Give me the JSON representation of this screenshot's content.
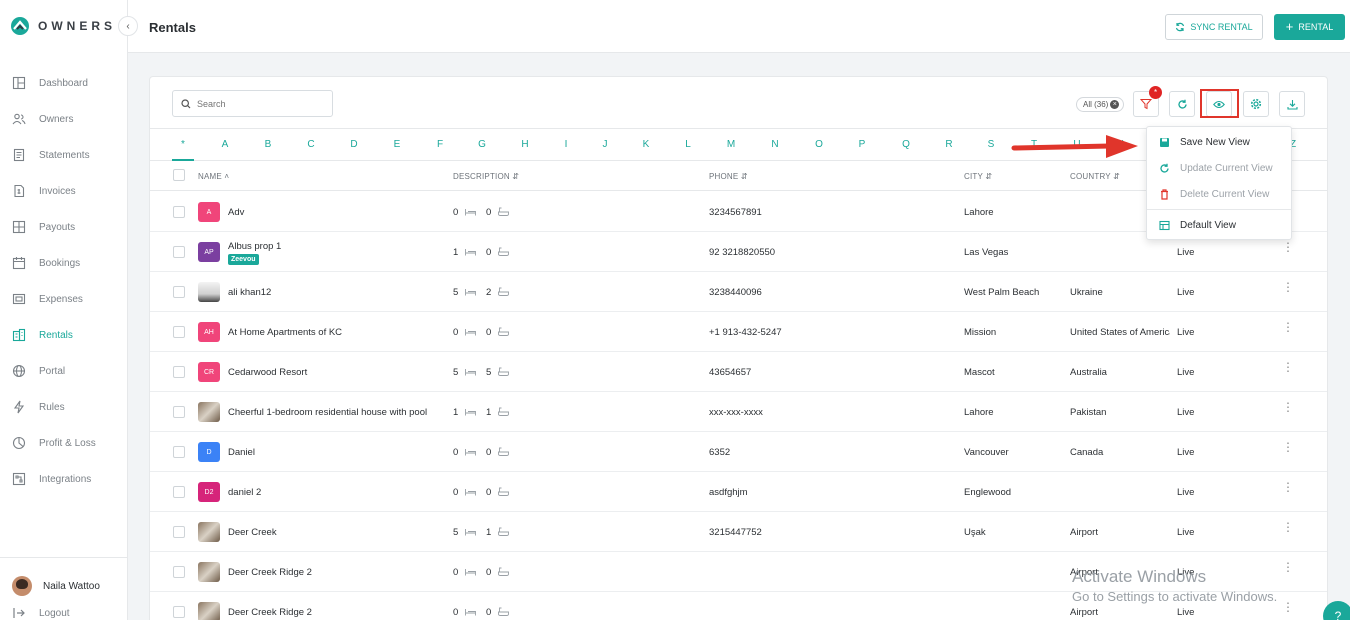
{
  "app": {
    "logo_text": "OWNERS",
    "brand_color": "#1aa89a"
  },
  "sidebar": {
    "items": [
      {
        "label": "Dashboard",
        "icon": "dashboard-icon"
      },
      {
        "label": "Owners",
        "icon": "owners-icon"
      },
      {
        "label": "Statements",
        "icon": "statements-icon"
      },
      {
        "label": "Invoices",
        "icon": "invoices-icon"
      },
      {
        "label": "Payouts",
        "icon": "payouts-icon"
      },
      {
        "label": "Bookings",
        "icon": "bookings-icon"
      },
      {
        "label": "Expenses",
        "icon": "expenses-icon"
      },
      {
        "label": "Rentals",
        "icon": "rentals-icon",
        "active": true
      },
      {
        "label": "Portal",
        "icon": "globe-icon"
      },
      {
        "label": "Rules",
        "icon": "bolt-icon"
      },
      {
        "label": "Profit & Loss",
        "icon": "chart-icon"
      },
      {
        "label": "Integrations",
        "icon": "integrations-icon"
      }
    ],
    "user_name": "Naila Wattoo",
    "logout_label": "Logout"
  },
  "header": {
    "title": "Rentals",
    "sync_label": "SYNC RENTAL",
    "add_label": "RENTAL"
  },
  "toolbar": {
    "search_placeholder": "Search",
    "all_chip": "All (36)",
    "filter_badge": "*"
  },
  "alphabet": [
    "*",
    "A",
    "B",
    "C",
    "D",
    "E",
    "F",
    "G",
    "H",
    "I",
    "J",
    "K",
    "L",
    "M",
    "N",
    "O",
    "P",
    "Q",
    "R",
    "S",
    "T",
    "U",
    "V",
    "W",
    "X",
    "Y",
    "Z"
  ],
  "columns": {
    "name": "NAME",
    "description": "DESCRIPTION",
    "phone": "PHONE",
    "city": "CITY",
    "country": "COUNTRY"
  },
  "rows": [
    {
      "initials": "A",
      "color": "#f0457a",
      "name": "Adv",
      "beds": "0",
      "baths": "0",
      "phone": "3234567891",
      "city": "Lahore",
      "country": "",
      "status": ""
    },
    {
      "initials": "AP",
      "color": "#7b3fa0",
      "name": "Albus prop 1",
      "tag": "Zeevou",
      "beds": "1",
      "baths": "0",
      "phone": "92 3218820550",
      "city": "Las Vegas",
      "country": "",
      "status": "Live"
    },
    {
      "initials": "",
      "photo": "white",
      "name": "ali khan12",
      "beds": "5",
      "baths": "2",
      "phone": "3238440096",
      "city": "West Palm Beach",
      "country": "Ukraine",
      "status": "Live"
    },
    {
      "initials": "AH",
      "color": "#f0457a",
      "name": "At Home Apartments of KC",
      "beds": "0",
      "baths": "0",
      "phone": "+1 913-432-5247",
      "city": "Mission",
      "country": "United States of America",
      "status": "Live"
    },
    {
      "initials": "CR",
      "color": "#f0457a",
      "name": "Cedarwood Resort",
      "beds": "5",
      "baths": "5",
      "phone": "43654657",
      "city": "Mascot",
      "country": "Australia",
      "status": "Live"
    },
    {
      "initials": "",
      "photo": "photo",
      "name": "Cheerful 1-bedroom residential house with pool",
      "beds": "1",
      "baths": "1",
      "phone": "xxx-xxx-xxxx",
      "city": "Lahore",
      "country": "Pakistan",
      "status": "Live"
    },
    {
      "initials": "D",
      "color": "#3b82f6",
      "name": "Daniel",
      "beds": "0",
      "baths": "0",
      "phone": "6352",
      "city": "Vancouver",
      "country": "Canada",
      "status": "Live"
    },
    {
      "initials": "D2",
      "color": "#d6247a",
      "name": "daniel 2",
      "beds": "0",
      "baths": "0",
      "phone": "asdfghjm",
      "city": "Englewood",
      "country": "",
      "status": "Live"
    },
    {
      "initials": "",
      "photo": "photo",
      "name": "Deer Creek",
      "beds": "5",
      "baths": "1",
      "phone": "3215447752",
      "city": "Uşak",
      "country": "Airport",
      "status": "Live"
    },
    {
      "initials": "",
      "photo": "photo",
      "name": "Deer Creek Ridge 2",
      "beds": "0",
      "baths": "0",
      "phone": "",
      "city": "",
      "country": "Airport",
      "status": "Live"
    },
    {
      "initials": "",
      "photo": "photo",
      "name": "Deer Creek Ridge 2",
      "beds": "0",
      "baths": "0",
      "phone": "",
      "city": "",
      "country": "Airport",
      "status": "Live"
    }
  ],
  "view_menu": {
    "items": [
      {
        "label": "Save New View",
        "icon": "save-icon",
        "disabled": false
      },
      {
        "label": "Update Current View",
        "icon": "refresh-icon",
        "disabled": true
      },
      {
        "label": "Delete Current View",
        "icon": "trash-icon",
        "disabled": true
      },
      {
        "label": "Default View",
        "icon": "table-icon",
        "disabled": false
      }
    ]
  },
  "watermark": {
    "line1": "Activate Windows",
    "line2": "Go to Settings to activate Windows."
  }
}
